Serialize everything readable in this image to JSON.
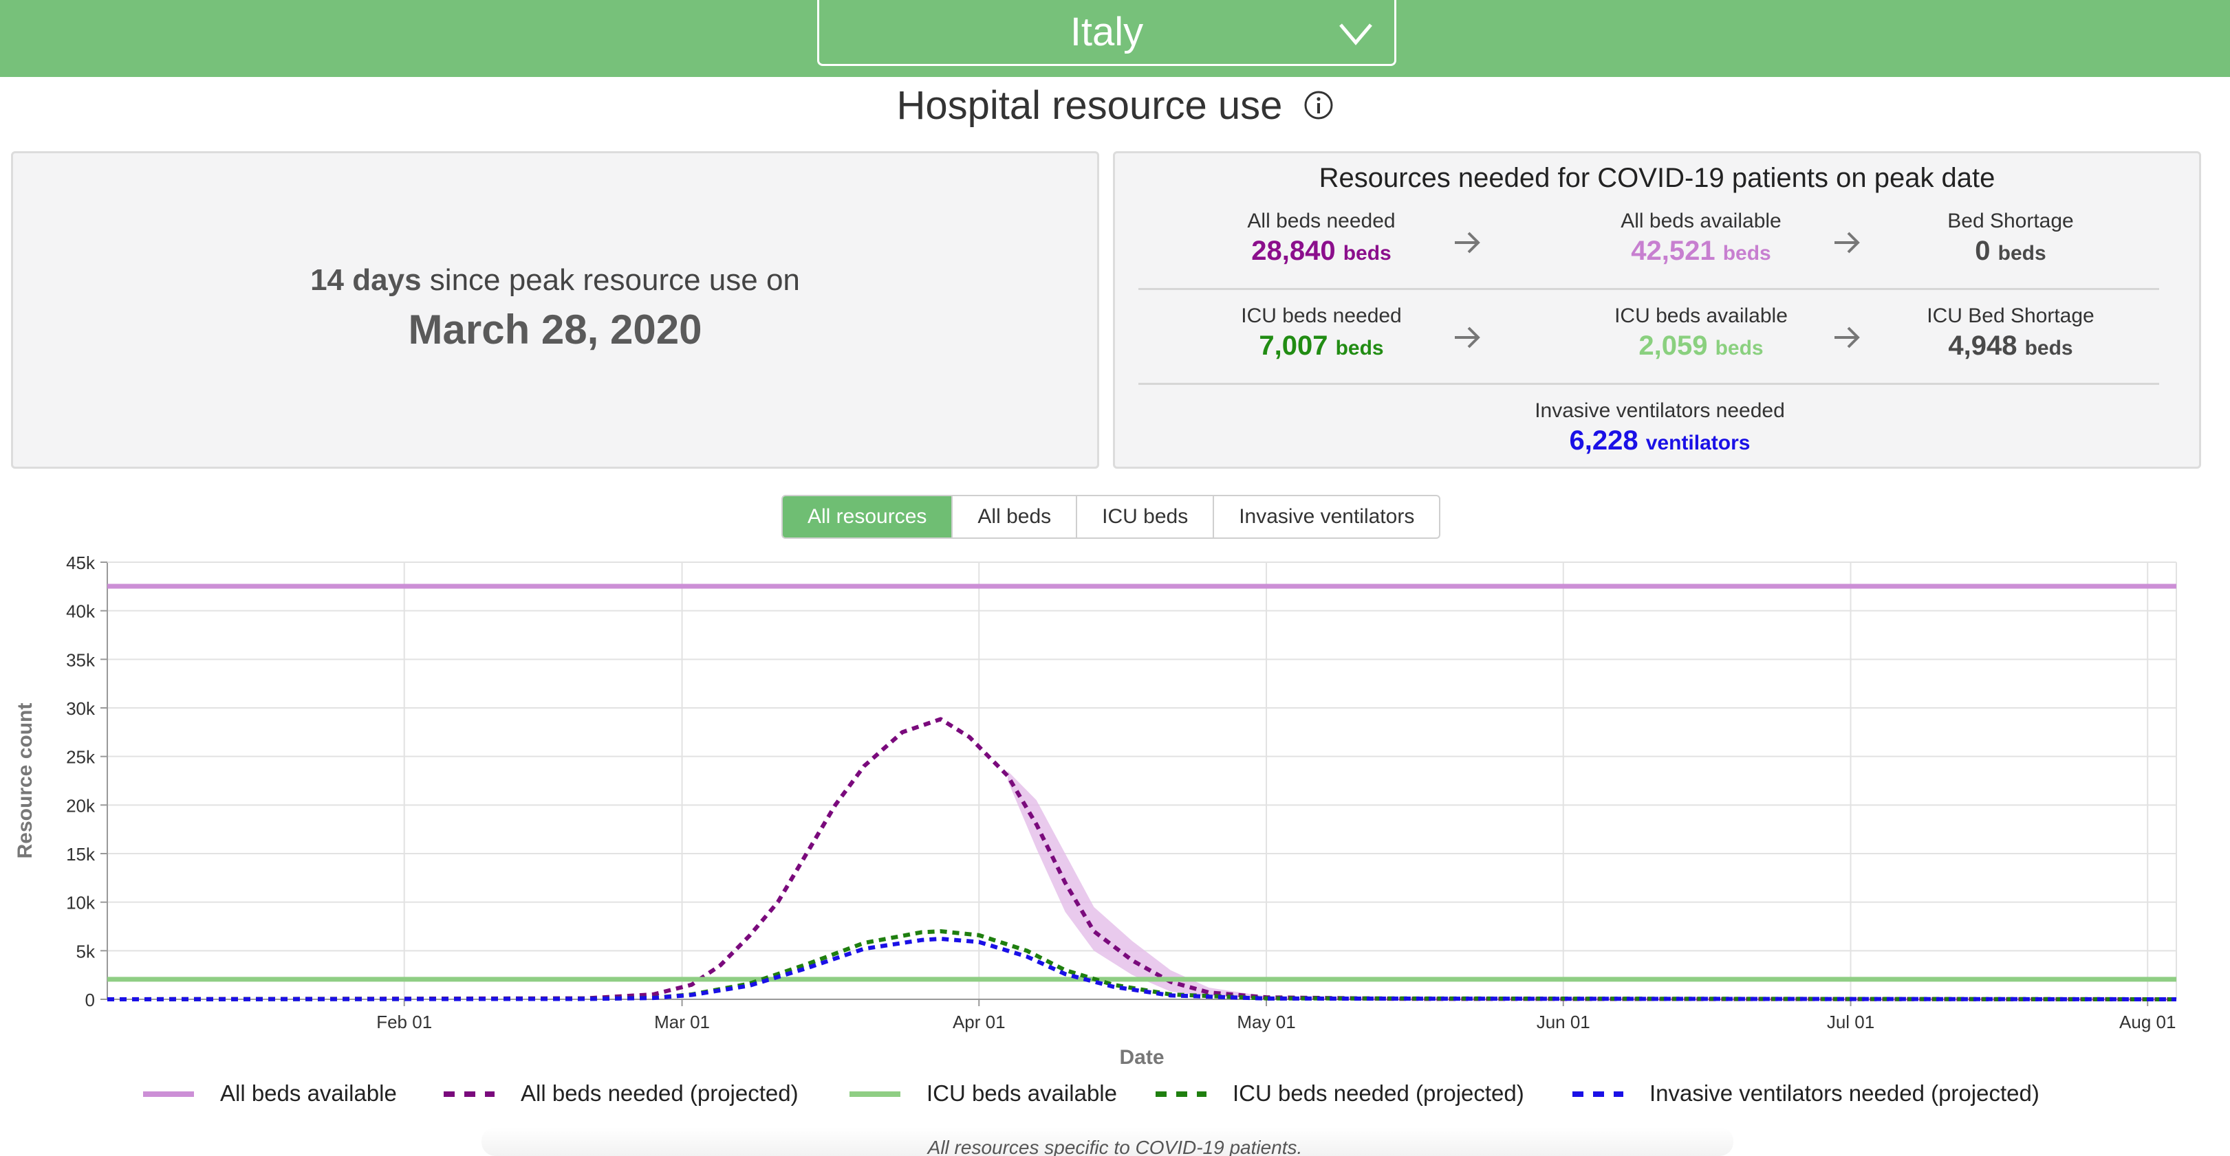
{
  "header": {
    "country": "Italy",
    "colors": {
      "bar": "#77c17a"
    }
  },
  "page": {
    "title": "Hospital resource use",
    "title_icon": "info-icon"
  },
  "peak_panel": {
    "days_count": "14",
    "days_word": "days",
    "since_text": "since peak resource use on",
    "peak_date": "March 28, 2020"
  },
  "resources_panel": {
    "title": "Resources needed for COVID-19 patients on peak date",
    "row1": [
      {
        "label": "All beds needed",
        "value": "28,840",
        "unit": "beds",
        "color": "#8b0f8c"
      },
      {
        "label": "All beds available",
        "value": "42,521",
        "unit": "beds",
        "color": "#c77fd0"
      },
      {
        "label": "Bed Shortage",
        "value": "0",
        "unit": "beds",
        "color": "#4a4a4a"
      }
    ],
    "row2": [
      {
        "label": "ICU beds needed",
        "value": "7,007",
        "unit": "beds",
        "color": "#218c13"
      },
      {
        "label": "ICU beds available",
        "value": "2,059",
        "unit": "beds",
        "color": "#8ad07f"
      },
      {
        "label": "ICU Bed Shortage",
        "value": "4,948",
        "unit": "beds",
        "color": "#4a4a4a"
      }
    ],
    "row3": {
      "label": "Invasive ventilators needed",
      "value": "6,228",
      "unit": "ventilators",
      "color": "#1a10e6"
    }
  },
  "tabs": [
    {
      "label": "All resources",
      "active": true
    },
    {
      "label": "All beds",
      "active": false
    },
    {
      "label": "ICU beds",
      "active": false
    },
    {
      "label": "Invasive ventilators",
      "active": false
    }
  ],
  "chart_data": {
    "type": "line",
    "title": "",
    "xlabel": "Date",
    "ylabel": "Resource count",
    "x_range": [
      "2020-01-01",
      "2020-08-04"
    ],
    "ylim": [
      0,
      45000
    ],
    "y_ticks": [
      0,
      5000,
      10000,
      15000,
      20000,
      25000,
      30000,
      35000,
      40000,
      45000
    ],
    "y_tick_labels": [
      "0",
      "5k",
      "10k",
      "15k",
      "20k",
      "25k",
      "30k",
      "35k",
      "40k",
      "45k"
    ],
    "x_ticks": [
      "2020-02-01",
      "2020-03-01",
      "2020-04-01",
      "2020-05-01",
      "2020-06-01",
      "2020-07-01",
      "2020-08-01"
    ],
    "x_tick_labels": [
      "Feb 01",
      "Mar 01",
      "Apr 01",
      "May 01",
      "Jun 01",
      "Jul 01",
      "Aug 01"
    ],
    "grid": true,
    "legend_position": "bottom",
    "series": [
      {
        "name": "All beds available",
        "style": "solid",
        "color": "#cc8fd6",
        "points": [
          [
            "2020-01-01",
            42521
          ],
          [
            "2020-08-04",
            42521
          ]
        ]
      },
      {
        "name": "All beds needed (projected)",
        "style": "dashed",
        "color": "#7a0a7c",
        "points": [
          [
            "2020-01-01",
            0
          ],
          [
            "2020-02-20",
            100
          ],
          [
            "2020-02-27",
            500
          ],
          [
            "2020-03-02",
            1500
          ],
          [
            "2020-03-05",
            3500
          ],
          [
            "2020-03-08",
            6500
          ],
          [
            "2020-03-11",
            10000
          ],
          [
            "2020-03-14",
            15000
          ],
          [
            "2020-03-17",
            20000
          ],
          [
            "2020-03-20",
            24000
          ],
          [
            "2020-03-24",
            27500
          ],
          [
            "2020-03-28",
            28840
          ],
          [
            "2020-03-31",
            27000
          ],
          [
            "2020-04-04",
            23000
          ],
          [
            "2020-04-07",
            18000
          ],
          [
            "2020-04-10",
            12000
          ],
          [
            "2020-04-13",
            7000
          ],
          [
            "2020-04-17",
            4000
          ],
          [
            "2020-04-21",
            1800
          ],
          [
            "2020-04-25",
            700
          ],
          [
            "2020-05-01",
            200
          ],
          [
            "2020-05-15",
            50
          ],
          [
            "2020-08-04",
            0
          ]
        ]
      },
      {
        "name": "ICU beds available",
        "style": "solid",
        "color": "#8fce84",
        "points": [
          [
            "2020-01-01",
            2059
          ],
          [
            "2020-08-04",
            2059
          ]
        ]
      },
      {
        "name": "ICU beds needed (projected)",
        "style": "dashed",
        "color": "#1f7f0f",
        "points": [
          [
            "2020-01-01",
            0
          ],
          [
            "2020-02-20",
            50
          ],
          [
            "2020-02-27",
            150
          ],
          [
            "2020-03-02",
            500
          ],
          [
            "2020-03-08",
            1600
          ],
          [
            "2020-03-14",
            3600
          ],
          [
            "2020-03-20",
            5800
          ],
          [
            "2020-03-26",
            6900
          ],
          [
            "2020-03-28",
            7007
          ],
          [
            "2020-04-01",
            6600
          ],
          [
            "2020-04-06",
            5000
          ],
          [
            "2020-04-10",
            3000
          ],
          [
            "2020-04-15",
            1500
          ],
          [
            "2020-04-21",
            500
          ],
          [
            "2020-05-01",
            100
          ],
          [
            "2020-08-04",
            0
          ]
        ]
      },
      {
        "name": "Invasive ventilators needed (projected)",
        "style": "dashed",
        "color": "#1a10e6",
        "points": [
          [
            "2020-01-01",
            0
          ],
          [
            "2020-02-20",
            40
          ],
          [
            "2020-02-27",
            130
          ],
          [
            "2020-03-02",
            450
          ],
          [
            "2020-03-08",
            1400
          ],
          [
            "2020-03-14",
            3200
          ],
          [
            "2020-03-20",
            5200
          ],
          [
            "2020-03-26",
            6100
          ],
          [
            "2020-03-28",
            6228
          ],
          [
            "2020-04-01",
            5900
          ],
          [
            "2020-04-06",
            4400
          ],
          [
            "2020-04-10",
            2600
          ],
          [
            "2020-04-15",
            1300
          ],
          [
            "2020-04-21",
            400
          ],
          [
            "2020-05-01",
            80
          ],
          [
            "2020-08-04",
            0
          ]
        ]
      }
    ],
    "uncertainty_band": {
      "series": "All beds needed (projected)",
      "color": "#e3bde8",
      "upper": [
        [
          "2020-04-04",
          23500
        ],
        [
          "2020-04-07",
          20500
        ],
        [
          "2020-04-10",
          15000
        ],
        [
          "2020-04-13",
          9500
        ],
        [
          "2020-04-17",
          6000
        ],
        [
          "2020-04-21",
          3000
        ],
        [
          "2020-04-25",
          1200
        ],
        [
          "2020-05-01",
          300
        ]
      ],
      "lower": [
        [
          "2020-04-04",
          22500
        ],
        [
          "2020-04-07",
          15500
        ],
        [
          "2020-04-10",
          9000
        ],
        [
          "2020-04-13",
          5000
        ],
        [
          "2020-04-17",
          2500
        ],
        [
          "2020-04-21",
          800
        ],
        [
          "2020-04-25",
          300
        ],
        [
          "2020-05-01",
          100
        ]
      ]
    }
  },
  "footnote": "All resources specific to COVID-19 patients."
}
